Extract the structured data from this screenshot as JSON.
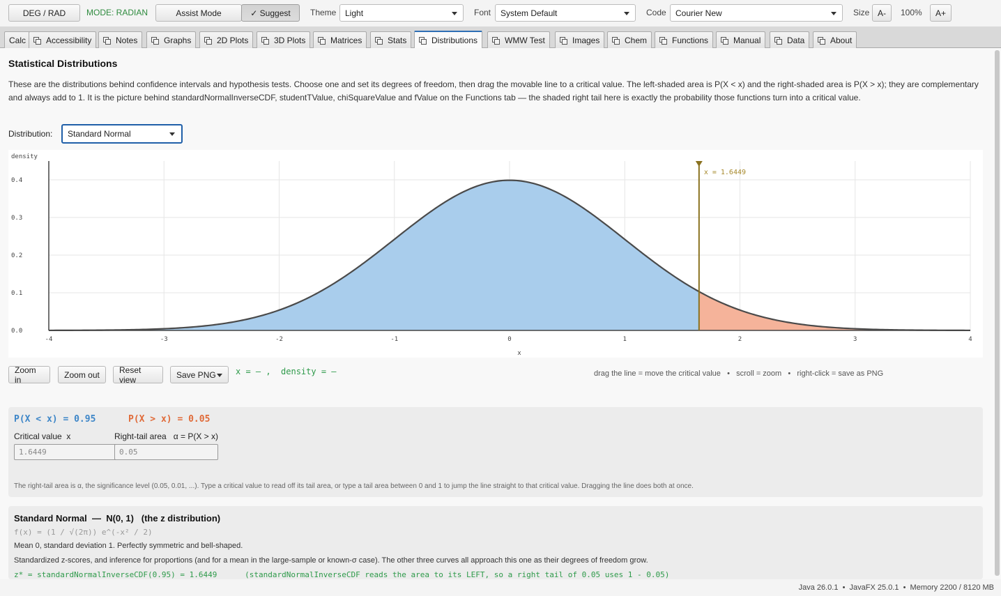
{
  "toolbar": {
    "deg_rad": "DEG / RAD",
    "mode": "MODE: RADIAN",
    "mode_color": "#2e8b3e",
    "assist": "Assist Mode",
    "suggest": "✓ Suggest",
    "theme_label": "Theme",
    "theme_value": "Light",
    "font_label": "Font",
    "font_value": "System Default",
    "code_label": "Code",
    "code_value": "Courier New",
    "size_label": "Size",
    "size_dec": "A-",
    "size_value": "100%",
    "size_inc": "A+"
  },
  "tabs": [
    "Calc",
    "Accessibility",
    "Notes",
    "Graphs",
    "2D Plots",
    "3D Plots",
    "Matrices",
    "Stats",
    "Distributions",
    "WMW Test",
    "Images",
    "Chem",
    "Functions",
    "Manual",
    "Data",
    "About"
  ],
  "active_tab": "Distributions",
  "page": {
    "title": "Statistical Distributions",
    "intro": "These are the distributions behind confidence intervals and hypothesis tests. Choose one and set its degrees of freedom, then drag the movable line to a critical value. The left-shaded area is P(X < x) and the right-shaded area is P(X > x); they are complementary and always add to 1. It is the picture behind standardNormalInverseCDF, studentTValue, chiSquareValue and fValue on the Functions tab — the shaded right tail here is exactly the probability those functions turn into a critical value.",
    "distribution_label": "Distribution:",
    "distribution_value": "Standard Normal"
  },
  "chart_data": {
    "type": "area",
    "xlabel": "x",
    "ylabel": "density",
    "xlim": [
      -4,
      4
    ],
    "ylim": [
      0,
      0.45
    ],
    "x_ticks": [
      -4,
      -3,
      -2,
      -1,
      0,
      1,
      2,
      3,
      4
    ],
    "y_ticks": [
      0.0,
      0.1,
      0.2,
      0.3,
      0.4
    ],
    "y_tick_labels": [
      "0.0",
      "0.1",
      "0.2",
      "0.3",
      "0.4"
    ],
    "distribution": "Standard Normal N(0, 1)",
    "critical_value": 1.6449,
    "critical_label": "x = 1.6449",
    "grid": true,
    "colors": {
      "left_fill": "#a9cdec",
      "right_fill": "#f5b39a",
      "curve": "#4a4a4a",
      "critical_line": "#8a7220"
    }
  },
  "controls": {
    "zoom_in": "Zoom in",
    "zoom_out": "Zoom out",
    "reset": "Reset view",
    "save_png": "Save PNG",
    "readout": "x = — ,  density = —",
    "hint": "drag the line = move the critical value   •   scroll = zoom   •   right-click = save as PNG"
  },
  "probabilities": {
    "left": "P(X < x) = 0.95",
    "right": "P(X > x) = 0.05",
    "critical_label": "Critical value  x",
    "critical_value": "1.6449",
    "tail_label": "Right-tail area   α = P(X > x)",
    "tail_value": "0.05",
    "note": "The right-tail area is α, the significance level (0.05, 0.01, ...). Type a critical value to read off its tail area, or type a tail area between 0 and 1 to jump the line straight to that critical value. Dragging the line does both at once."
  },
  "info": {
    "title": "Standard Normal  —  N(0, 1)   (the z distribution)",
    "formula": "f(x) = (1 / √(2π)) e^(-x² / 2)",
    "line1": "Mean 0, standard deviation 1. Perfectly symmetric and bell-shaped.",
    "line2": "Standardized z-scores, and inference for proportions (and for a mean in the large-sample or known-σ case). The other three curves all approach this one as their degrees of freedom grow.",
    "code": "z* = standardNormalInverseCDF(0.95) = 1.6449      (standardNormalInverseCDF reads the area to its LEFT, so a right tail of 0.05 uses 1 - 0.05)"
  },
  "status": "Java 26.0.1  •  JavaFX 25.0.1  •  Memory 2200 / 8120 MB"
}
